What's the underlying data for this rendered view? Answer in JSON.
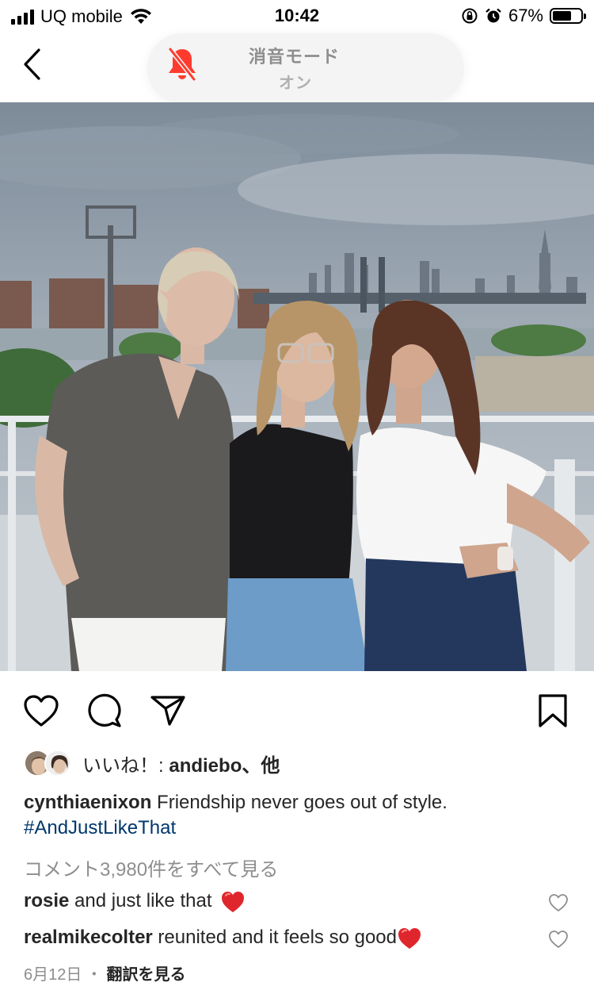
{
  "status_bar": {
    "carrier": "UQ mobile",
    "time": "10:42",
    "battery_percent_label": "67%",
    "battery_level": 0.67
  },
  "silent_mode": {
    "title": "消音モード",
    "state": "オン",
    "accent_color": "#ff3b30"
  },
  "photo": {
    "subject": "three women on a rooftop with city skyline"
  },
  "post": {
    "likes_prefix": "いいね！: ",
    "likes_user": "andiebo",
    "likes_suffix": "、他",
    "caption_user": "cynthiaenixon",
    "caption_text": " Friendship never goes out of style.",
    "caption_hashtag": "#AndJustLikeThat",
    "view_comments": "コメント3,980件をすべて見る",
    "comments": [
      {
        "user": "rosie",
        "text": " and just like that "
      },
      {
        "user": "realmikecolter",
        "text": " reunited and it feels so good"
      }
    ],
    "date": "6月12日",
    "separator": " ・ ",
    "translate": "翻訳を見る"
  },
  "colors": {
    "text": "#262626",
    "secondary": "#8e8e8e",
    "hashtag": "#00376b",
    "heart_red": "#ed4956"
  }
}
